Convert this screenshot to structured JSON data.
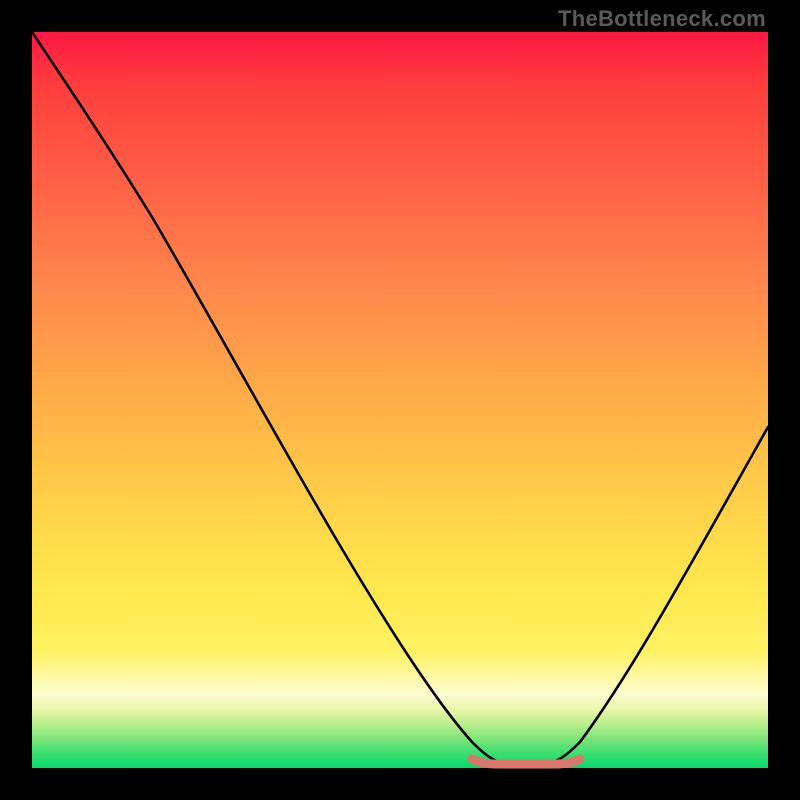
{
  "watermark": "TheBottleneck.com",
  "colors": {
    "frame": "#000000",
    "curve": "#000000",
    "plateau": "#d9776a",
    "gradient_top": "#ff1744",
    "gradient_bottom": "#05d96a"
  },
  "chart_data": {
    "type": "line",
    "title": "",
    "xlabel": "",
    "ylabel": "",
    "xlim": [
      0,
      100
    ],
    "ylim": [
      0,
      100
    ],
    "annotations": [
      "TheBottleneck.com"
    ],
    "grid": false,
    "legend": false,
    "series": [
      {
        "name": "bottleneck-curve",
        "x": [
          0,
          5,
          10,
          15,
          20,
          25,
          30,
          35,
          40,
          45,
          50,
          55,
          60,
          62,
          65,
          70,
          72,
          75,
          80,
          85,
          90,
          95,
          100
        ],
        "y": [
          100,
          92,
          84,
          76,
          67,
          58,
          49,
          40,
          31,
          22,
          13,
          7,
          3,
          1,
          1,
          1,
          3,
          7,
          15,
          25,
          35,
          45,
          55
        ]
      },
      {
        "name": "optimal-plateau",
        "x": [
          60,
          62,
          65,
          70,
          72
        ],
        "y": [
          1.2,
          0.6,
          0.6,
          0.6,
          1.2
        ]
      }
    ]
  }
}
